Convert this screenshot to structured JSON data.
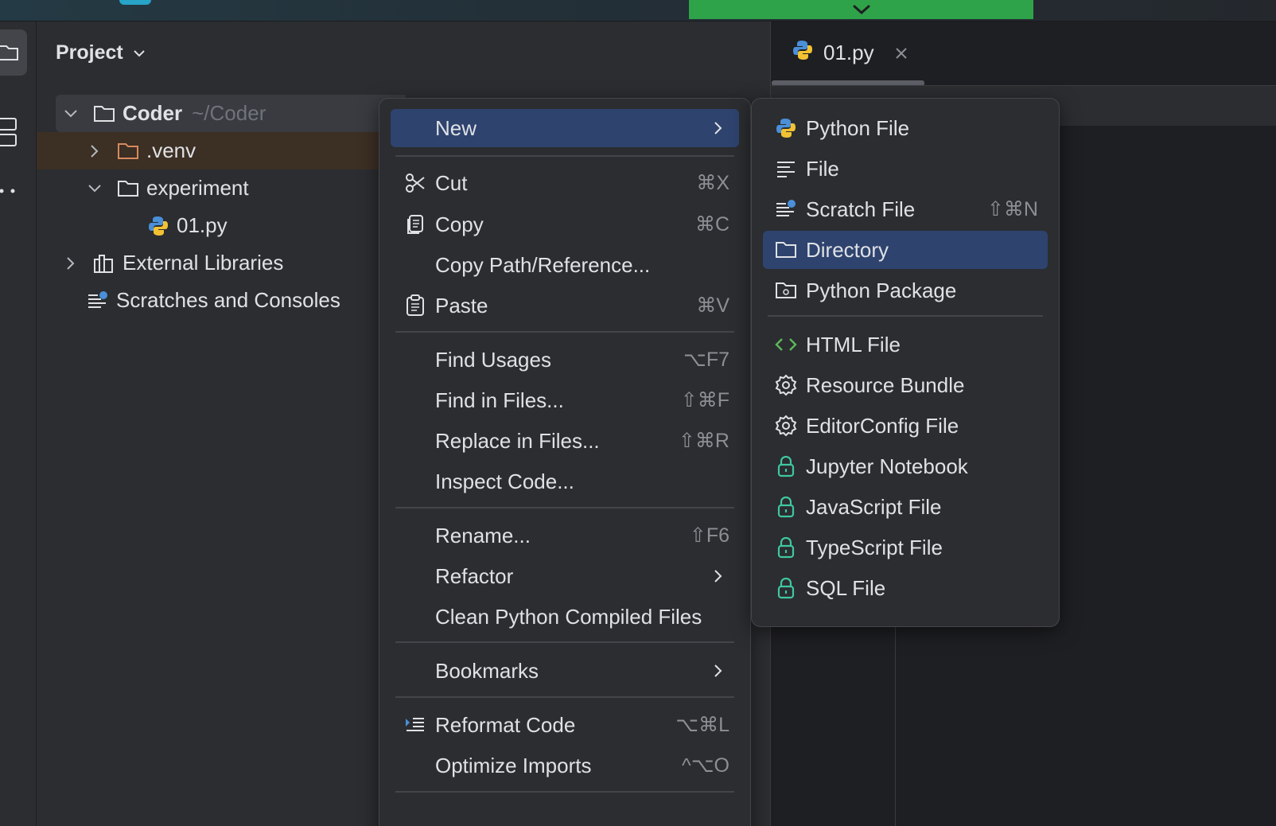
{
  "project_panel": {
    "title": "Project",
    "tree": {
      "root": {
        "label": "Coder",
        "path": "~/Coder"
      },
      "venv": {
        "label": ".venv"
      },
      "experiment": {
        "label": "experiment"
      },
      "file": {
        "label": "01.py"
      },
      "external": {
        "label": "External Libraries"
      },
      "scratches": {
        "label": "Scratches and Consoles"
      }
    }
  },
  "editor": {
    "tab": {
      "label": "01.py"
    }
  },
  "context_menu": {
    "items": [
      {
        "label": "New",
        "shortcut": "",
        "submenu": true,
        "selected": true
      },
      {
        "label": "Cut",
        "shortcut": "⌘X"
      },
      {
        "label": "Copy",
        "shortcut": "⌘C"
      },
      {
        "label": "Copy Path/Reference...",
        "shortcut": ""
      },
      {
        "label": "Paste",
        "shortcut": "⌘V"
      },
      {
        "label": "Find Usages",
        "shortcut": "⌥F7"
      },
      {
        "label": "Find in Files...",
        "shortcut": "⇧⌘F"
      },
      {
        "label": "Replace in Files...",
        "shortcut": "⇧⌘R"
      },
      {
        "label": "Inspect Code...",
        "shortcut": ""
      },
      {
        "label": "Rename...",
        "shortcut": "⇧F6"
      },
      {
        "label": "Refactor",
        "shortcut": "",
        "submenu": true
      },
      {
        "label": "Clean Python Compiled Files",
        "shortcut": ""
      },
      {
        "label": "Bookmarks",
        "shortcut": "",
        "submenu": true
      },
      {
        "label": "Reformat Code",
        "shortcut": "⌥⌘L"
      },
      {
        "label": "Optimize Imports",
        "shortcut": "^⌥O"
      }
    ]
  },
  "new_submenu": {
    "items": [
      {
        "label": "Python File",
        "icon": "python-icon"
      },
      {
        "label": "File",
        "icon": "text-file-icon"
      },
      {
        "label": "Scratch File",
        "icon": "scratch-file-icon",
        "shortcut": "⇧⌘N"
      },
      {
        "label": "Directory",
        "icon": "folder-icon",
        "selected": true
      },
      {
        "label": "Python Package",
        "icon": "package-icon"
      },
      {
        "label": "HTML File",
        "icon": "html-icon"
      },
      {
        "label": "Resource Bundle",
        "icon": "gear-icon"
      },
      {
        "label": "EditorConfig File",
        "icon": "gear-icon"
      },
      {
        "label": "Jupyter Notebook",
        "icon": "lock-icon"
      },
      {
        "label": "JavaScript File",
        "icon": "lock-icon"
      },
      {
        "label": "TypeScript File",
        "icon": "lock-icon"
      },
      {
        "label": "SQL File",
        "icon": "lock-icon"
      }
    ]
  },
  "colors": {
    "selection": "#2e436e",
    "accent_green": "#2fa34a",
    "venv_row": "#3c2f24",
    "lock_icon": "#3fc7a0"
  }
}
